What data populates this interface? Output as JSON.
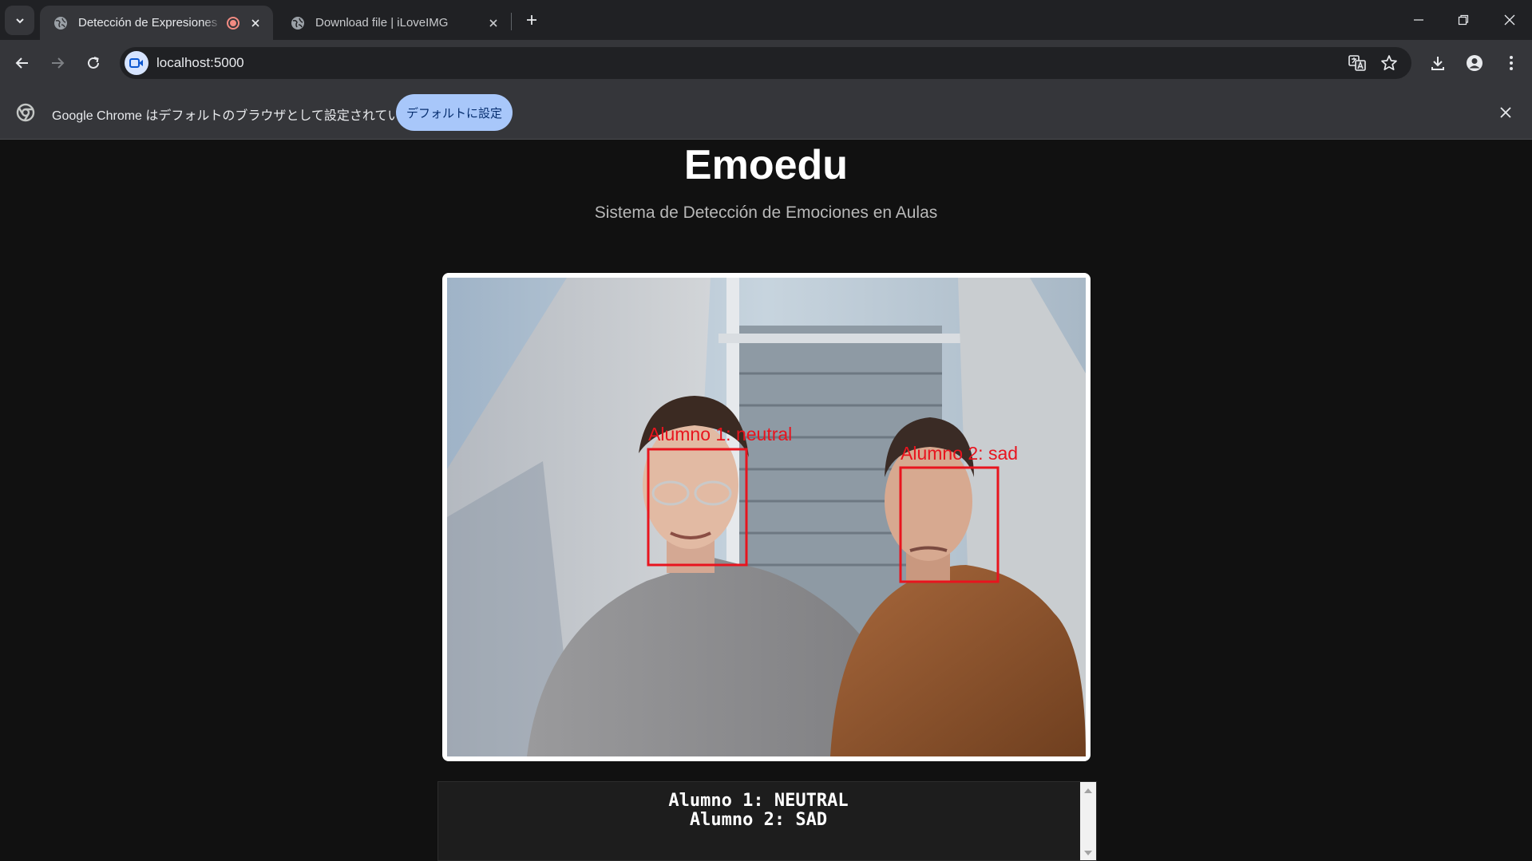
{
  "browser": {
    "tabs": [
      {
        "title": "Detección de Expresiones Faciales",
        "active": true,
        "recording": true
      },
      {
        "title": "Download file | iLoveIMG",
        "active": false,
        "recording": false
      }
    ],
    "url": "localhost:5000",
    "infobar": {
      "message": "Google Chrome はデフォルトのブラウザとして設定されていません",
      "button_label": "デフォルトに設定"
    }
  },
  "app": {
    "title": "Emoedu",
    "subtitle": "Sistema de Detección de Emociones en Aulas"
  },
  "detections": [
    {
      "label": "Alumno 1: neutral"
    },
    {
      "label": "Alumno 2: sad"
    }
  ],
  "log": {
    "lines": [
      "Alumno 1: NEUTRAL",
      "Alumno 2: SAD"
    ]
  },
  "colors": {
    "detection_box": "#e8141e",
    "accent_button": "#a8c7fa",
    "background": "#111111"
  }
}
